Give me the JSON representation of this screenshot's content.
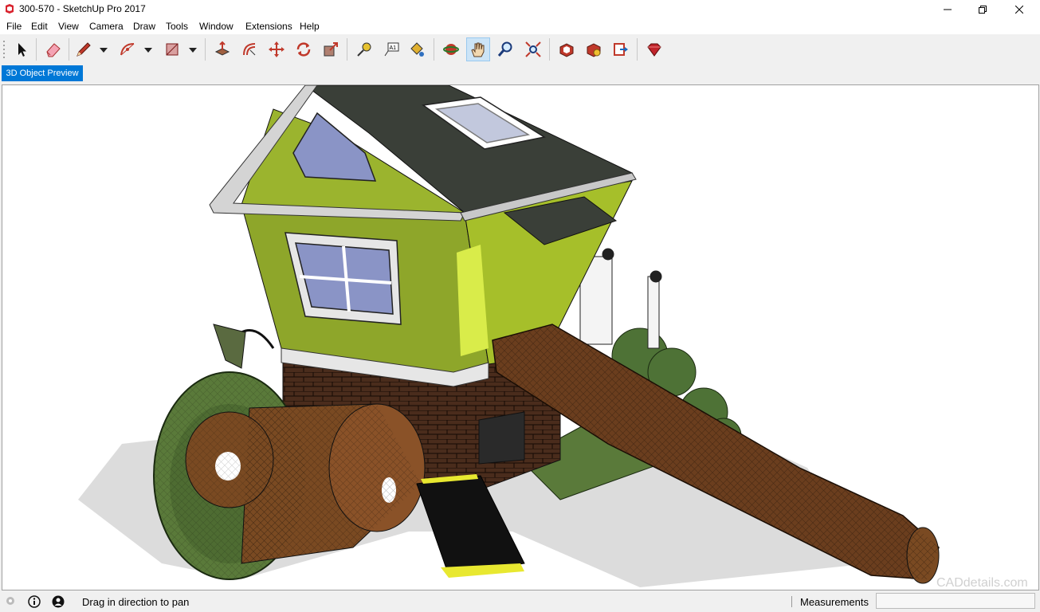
{
  "window": {
    "title": "300-570 - SketchUp Pro 2017"
  },
  "menu": [
    "File",
    "Edit",
    "View",
    "Camera",
    "Draw",
    "Tools",
    "Window",
    "Extensions",
    "Help"
  ],
  "toolbar": {
    "tools": [
      {
        "id": "select",
        "icon": "arrow-cursor-icon"
      },
      {
        "id": "eraser",
        "icon": "eraser-icon"
      },
      {
        "id": "line",
        "icon": "pencil-icon"
      },
      {
        "id": "arc",
        "icon": "arc-icon"
      },
      {
        "id": "shapes",
        "icon": "rectangle-icon"
      },
      {
        "id": "push-pull",
        "icon": "push-pull-icon"
      },
      {
        "id": "offset",
        "icon": "offset-icon"
      },
      {
        "id": "move",
        "icon": "move-icon"
      },
      {
        "id": "rotate",
        "icon": "rotate-icon"
      },
      {
        "id": "scale",
        "icon": "scale-icon"
      },
      {
        "id": "tape-measure",
        "icon": "tape-measure-icon"
      },
      {
        "id": "text",
        "icon": "text-label-icon"
      },
      {
        "id": "paint-bucket",
        "icon": "paint-bucket-icon"
      },
      {
        "id": "orbit",
        "icon": "orbit-icon"
      },
      {
        "id": "pan",
        "icon": "hand-icon",
        "active": true
      },
      {
        "id": "zoom",
        "icon": "zoom-icon"
      },
      {
        "id": "zoom-extents",
        "icon": "zoom-extents-icon"
      },
      {
        "id": "warehouse",
        "icon": "3d-warehouse-icon"
      },
      {
        "id": "extension-warehouse",
        "icon": "extension-warehouse-icon"
      },
      {
        "id": "layout",
        "icon": "send-to-layout-icon"
      },
      {
        "id": "ruby",
        "icon": "ruby-gem-icon"
      }
    ]
  },
  "tabs": [
    {
      "label": "3D Object Preview",
      "active": true
    }
  ],
  "status": {
    "hint": "Drag in direction to pan",
    "measurements_label": "Measurements",
    "measurements_value": ""
  },
  "viewport": {
    "watermark": "CADdetails.com"
  },
  "colors": {
    "accent": "#0078d7",
    "house_wall": "#8ea62a",
    "roof": "#3a3f38",
    "brick": "#4a2c1c",
    "wood": "#6b3e1e",
    "foliage": "#5a7a3a"
  }
}
